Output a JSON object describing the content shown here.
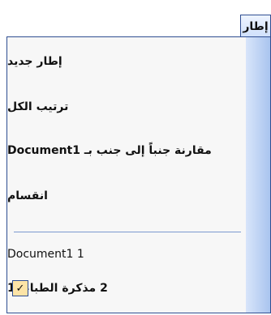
{
  "menu": {
    "title": "إطار",
    "items": [
      {
        "label": "إطار جديد"
      },
      {
        "label": "ترتيب الكل"
      },
      {
        "label": "مقارنة جنباً إلى جنب بـ Document1"
      },
      {
        "label": "انقسام"
      },
      {
        "label": "Document1 1"
      },
      {
        "label": "2 مذكرة الطباعة1",
        "checked": true,
        "check_glyph": "✓"
      }
    ]
  }
}
